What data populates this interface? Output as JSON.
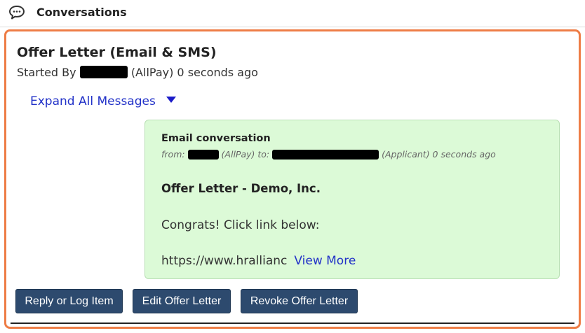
{
  "header": {
    "title": "Conversations",
    "icon": "chat-bubble-icon"
  },
  "conversation": {
    "title": "Offer Letter (Email & SMS)",
    "started_by_prefix": "Started By",
    "started_by_suffix": "(AllPay) 0 seconds ago",
    "expand_label": "Expand All Messages"
  },
  "email": {
    "type_label": "Email conversation",
    "from_label": "from:",
    "from_org": "(AllPay) to:",
    "to_suffix": "(Applicant) 0 seconds ago",
    "subject": "Offer Letter - Demo, Inc.",
    "body_line1": "Congrats! Click link below:",
    "body_line2": "https://www.hrallianc",
    "view_more": "View More"
  },
  "actions": {
    "reply": "Reply or Log Item",
    "edit": "Edit Offer Letter",
    "revoke": "Revoke Offer Letter"
  },
  "colors": {
    "accent_border": "#ee7d46",
    "email_bg": "#dcfad7",
    "button_bg": "#2d4a6e",
    "link": "#2232c8"
  }
}
